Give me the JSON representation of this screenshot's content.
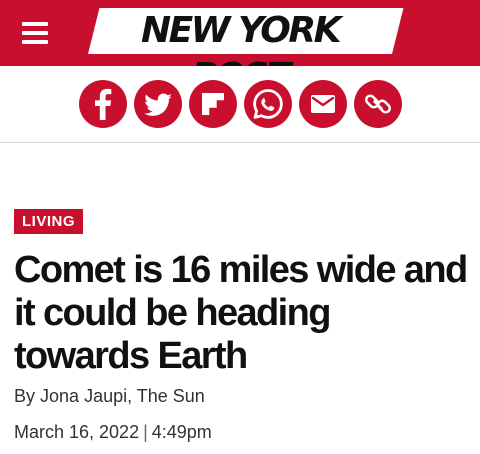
{
  "header": {
    "logo_text": "NEW YORK POST",
    "brand_color": "#c8102e",
    "menu_icon": "hamburger-menu-icon"
  },
  "share": {
    "buttons": [
      {
        "name": "facebook",
        "icon": "facebook-icon"
      },
      {
        "name": "twitter",
        "icon": "twitter-bird-icon"
      },
      {
        "name": "flipboard",
        "icon": "flipboard-icon"
      },
      {
        "name": "whatsapp",
        "icon": "whatsapp-icon"
      },
      {
        "name": "email",
        "icon": "envelope-icon"
      },
      {
        "name": "copy-link",
        "icon": "link-icon"
      }
    ]
  },
  "article": {
    "section_tag": "LIVING",
    "headline": "Comet is 16 miles wide and it could be heading towards Earth",
    "byline_prefix": "By",
    "authors": "Jona Jaupi, The Sun",
    "date": "March 16, 2022",
    "separator": "|",
    "time": "4:49pm"
  }
}
